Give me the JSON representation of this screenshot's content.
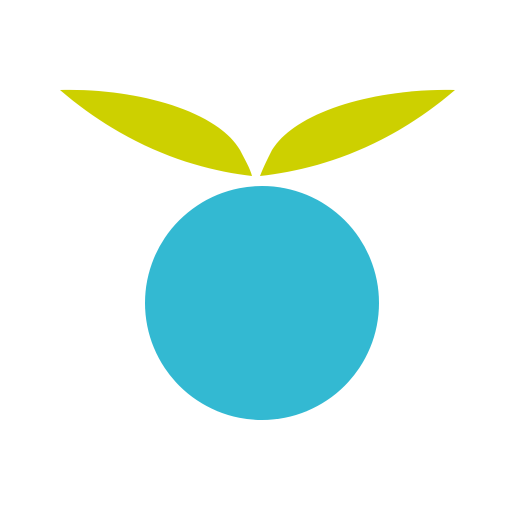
{
  "logo": {
    "icon": "berry-with-leaves-icon",
    "colors": {
      "background": "#ffffff",
      "berry": "#33b9d2",
      "leaf": "#cdd000"
    }
  }
}
